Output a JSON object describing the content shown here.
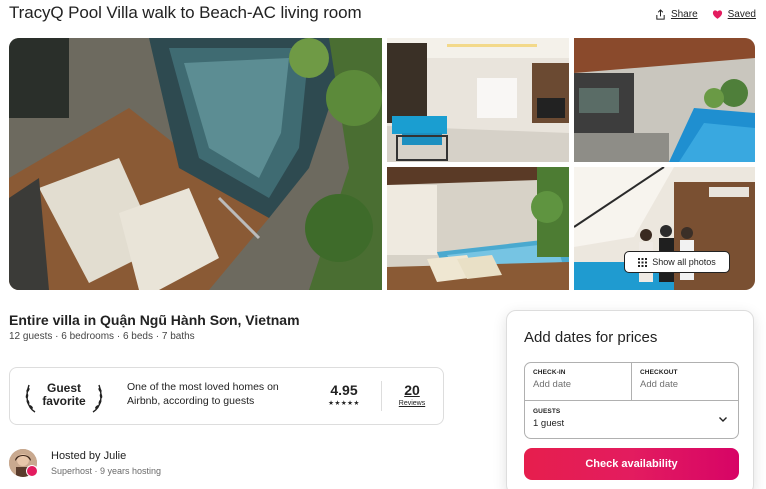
{
  "listing": {
    "title": "TracyQ Pool Villa walk to Beach-AC living room",
    "type_location": "Entire villa in Quận Ngũ Hành Sơn, Vietnam",
    "details": "12 guests · 6 bedrooms · 6 beds · 7 baths"
  },
  "actions": {
    "share": "Share",
    "saved": "Saved"
  },
  "gallery": {
    "show_all_label": "Show all photos"
  },
  "guest_favorite": {
    "label_line1": "Guest",
    "label_line2": "favorite",
    "description": "One of the most loved homes on Airbnb, according to guests",
    "rating": "4.95",
    "stars": "★★★★★",
    "reviews_count": "20",
    "reviews_label": "Reviews"
  },
  "host": {
    "name": "Hosted by Julie",
    "meta": "Superhost · 9 years hosting"
  },
  "booking": {
    "heading": "Add dates for prices",
    "checkin_label": "CHECK-IN",
    "checkin_value": "Add date",
    "checkout_label": "CHECKOUT",
    "checkout_value": "Add date",
    "guests_label": "GUESTS",
    "guests_value": "1 guest",
    "cta": "Check availability"
  },
  "colors": {
    "brand": "#e31c5f",
    "saved_heart": "#e31c5f",
    "text": "#222222",
    "muted": "#6a6a6a"
  },
  "icons": {
    "share": "share-icon",
    "saved": "heart-icon",
    "show_all": "grid-icon",
    "laurel": "laurel-icon",
    "guests_dropdown": "chevron-down-icon"
  }
}
